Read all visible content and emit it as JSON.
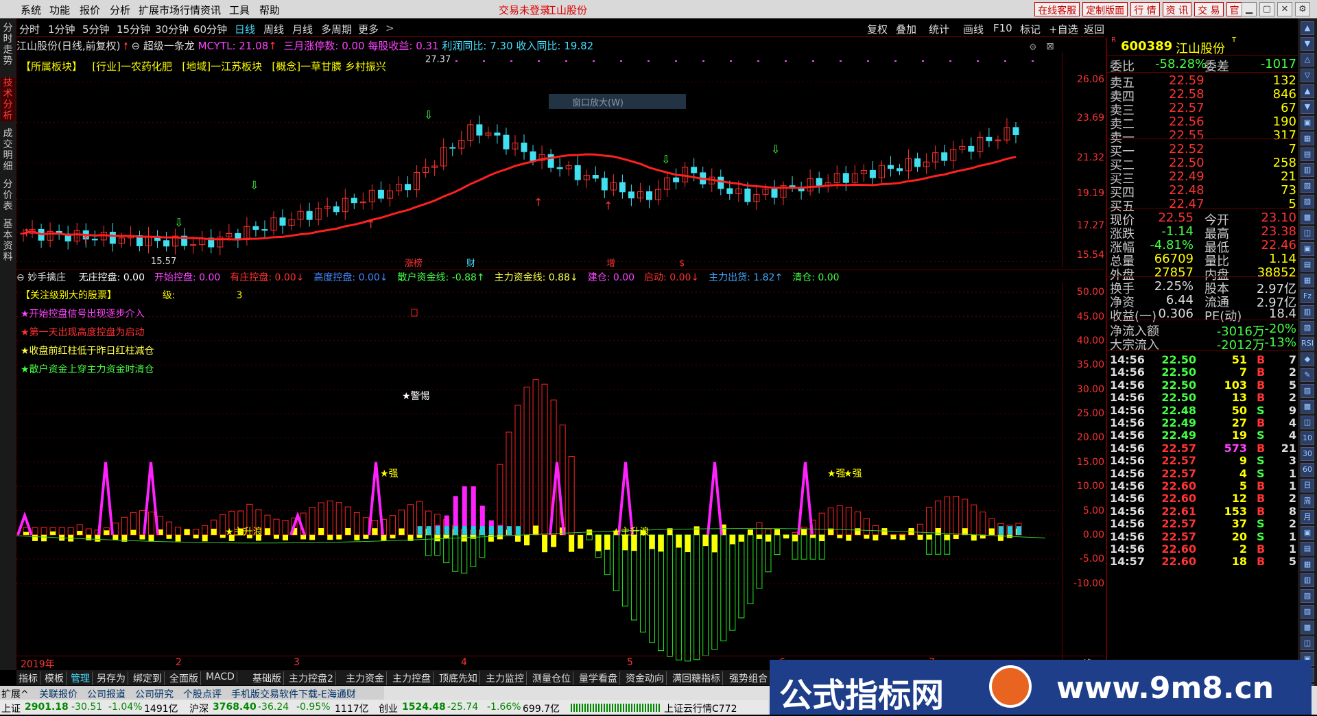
{
  "menu": [
    "系统",
    "功能",
    "报价",
    "分析",
    "扩展市场行情",
    "资讯",
    "工具",
    "帮助"
  ],
  "header_center": {
    "login": "交易未登录",
    "stock": "江山股份"
  },
  "top_buttons": [
    "在线客服",
    "定制版面",
    "行 情",
    "资 讯",
    "交 易",
    "官 网"
  ],
  "left_tabs": [
    "分时走势",
    "技术分析",
    "成交明细",
    "分价表",
    "基本资料"
  ],
  "periods": [
    "分时",
    "1分钟",
    "5分钟",
    "15分钟",
    "30分钟",
    "60分钟",
    "日线",
    "周线",
    "月线",
    "多周期",
    "更多"
  ],
  "toolbar": [
    "复权",
    "叠加",
    "统计",
    "画线",
    "F10",
    "标记",
    "+自选",
    "返回"
  ],
  "main_chart": {
    "title": "江山股份(日线,前复权)",
    "indicator": "超级一条龙",
    "mcytl": "MCYTL: 21.08",
    "march": "三月涨停数: 0.00",
    "eps": "每股收益: 0.31",
    "profit": "利润同比: 7.30",
    "income": "收入同比: 19.82",
    "plates": [
      "【所属板块】",
      "[行业]一农药化肥",
      "[地域]一江苏板块",
      "[概念]一草甘膦 乡村振兴"
    ],
    "high_label": "27.37",
    "low_label": "15.57",
    "yticks": [
      "26.06",
      "23.69",
      "21.32",
      "19.19",
      "17.27",
      "15.54"
    ],
    "markers": [
      "涨榜",
      "财",
      "增",
      "$"
    ],
    "chart_data": {
      "type": "candlestick",
      "ma_color_up": "#ff2020",
      "ma_color_down": "#44dd44",
      "up_color": "#ff3030",
      "down_color": "#40e0f0",
      "yrange": [
        15.2,
        27.8
      ]
    }
  },
  "sub_chart": {
    "name": "妙手擒庄",
    "vals": [
      {
        "k": "无庄控盘:",
        "v": "0.00",
        "c": "#ffffff"
      },
      {
        "k": "开始控盘:",
        "v": "0.00",
        "c": "#ff44ff"
      },
      {
        "k": "有庄控盘:",
        "v": "0.00↓",
        "c": "#ff3030"
      },
      {
        "k": "高度控盘:",
        "v": "0.00↓",
        "c": "#4488ff"
      },
      {
        "k": "散户资金线:",
        "v": "-0.88↑",
        "c": "#44ff44"
      },
      {
        "k": "主力资金线:",
        "v": "0.88↓",
        "c": "#ffff44"
      },
      {
        "k": "建仓:",
        "v": "0.00",
        "c": "#ff44ff"
      },
      {
        "k": "启动:",
        "v": "0.00↓",
        "c": "#ff3030"
      },
      {
        "k": "主力出货:",
        "v": "1.82↑",
        "c": "#44aaff"
      },
      {
        "k": "清仓:",
        "v": "0.00",
        "c": "#44ff44"
      }
    ],
    "notes": [
      {
        "t": "【关注级别大的股票】",
        "c": "#ffff44"
      },
      {
        "t": "★开始控盘信号出现逐步介入",
        "c": "#ff44ff"
      },
      {
        "t": "★第一天出现高度控盘为启动",
        "c": "#ff3030"
      },
      {
        "t": "★收盘前红柱低于昨日红柱减仓",
        "c": "#ffff44"
      },
      {
        "t": "★散户资金上穿主力资金时清仓",
        "c": "#44ff44"
      }
    ],
    "level_label": "级:",
    "level_value": "3",
    "yticks": [
      "50.00",
      "45.00",
      "40.00",
      "35.00",
      "30.00",
      "25.00",
      "20.00",
      "15.00",
      "10.00",
      "5.00",
      "0.00",
      "-5.00",
      "-10.00"
    ],
    "labels": [
      "★警惕",
      "★强",
      "★强",
      "★强",
      "★主升浪",
      "★主升浪"
    ],
    "chart_data": {
      "type": "bar",
      "yrange": [
        -28,
        52
      ]
    }
  },
  "date_axis": [
    "2019年",
    "2",
    "3",
    "4",
    "5",
    "6",
    "7"
  ],
  "date_axis_right": "日线",
  "quote": {
    "code": "600389",
    "name": "江山股份",
    "weibi_label": "委比",
    "weibi": "-58.28%",
    "weicha_label": "委差",
    "weicha": "-1017",
    "sell": [
      {
        "l": "卖五",
        "p": "22.59",
        "v": "132"
      },
      {
        "l": "卖四",
        "p": "22.58",
        "v": "846"
      },
      {
        "l": "卖三",
        "p": "22.57",
        "v": "67"
      },
      {
        "l": "卖二",
        "p": "22.56",
        "v": "190"
      },
      {
        "l": "卖一",
        "p": "22.55",
        "v": "317"
      }
    ],
    "buy": [
      {
        "l": "买一",
        "p": "22.52",
        "v": "7"
      },
      {
        "l": "买二",
        "p": "22.50",
        "v": "258"
      },
      {
        "l": "买三",
        "p": "22.49",
        "v": "21"
      },
      {
        "l": "买四",
        "p": "22.48",
        "v": "73"
      },
      {
        "l": "买五",
        "p": "22.47",
        "v": "5"
      }
    ],
    "stats": [
      {
        "a": "现价",
        "av": "22.55",
        "b": "今开",
        "bv": "23.10"
      },
      {
        "a": "涨跌",
        "av": "-1.14",
        "b": "最高",
        "bv": "23.38"
      },
      {
        "a": "涨幅",
        "av": "-4.81%",
        "b": "最低",
        "bv": "22.46"
      },
      {
        "a": "总量",
        "av": "66709",
        "b": "量比",
        "bv": "1.14"
      },
      {
        "a": "外盘",
        "av": "27857",
        "b": "内盘",
        "bv": "38852"
      }
    ],
    "fund": [
      {
        "a": "换手",
        "av": "2.25%",
        "b": "股本",
        "bv": "2.97亿"
      },
      {
        "a": "净资",
        "av": "6.44",
        "b": "流通",
        "bv": "2.97亿"
      },
      {
        "a": "收益(一)",
        "av": "0.306",
        "b": "PE(动)",
        "bv": "18.4"
      }
    ],
    "flow": [
      {
        "a": "净流入额",
        "v": "-3016万",
        "p": "-20%"
      },
      {
        "a": "大宗流入",
        "v": "-2012万",
        "p": "-13%"
      }
    ],
    "ticks": [
      {
        "t": "14:56",
        "p": "22.50",
        "v": "51",
        "s": "B",
        "n": "7"
      },
      {
        "t": "14:56",
        "p": "22.50",
        "v": "7",
        "s": "B",
        "n": "2"
      },
      {
        "t": "14:56",
        "p": "22.50",
        "v": "103",
        "s": "B",
        "n": "5"
      },
      {
        "t": "14:56",
        "p": "22.50",
        "v": "13",
        "s": "B",
        "n": "2"
      },
      {
        "t": "14:56",
        "p": "22.48",
        "v": "50",
        "s": "S",
        "n": "9"
      },
      {
        "t": "14:56",
        "p": "22.49",
        "v": "27",
        "s": "B",
        "n": "4"
      },
      {
        "t": "14:56",
        "p": "22.49",
        "v": "19",
        "s": "S",
        "n": "4"
      },
      {
        "t": "14:56",
        "p": "22.57",
        "v": "573",
        "s": "B",
        "n": "21"
      },
      {
        "t": "14:56",
        "p": "22.57",
        "v": "9",
        "s": "S",
        "n": "3"
      },
      {
        "t": "14:56",
        "p": "22.57",
        "v": "4",
        "s": "S",
        "n": "1"
      },
      {
        "t": "14:56",
        "p": "22.60",
        "v": "5",
        "s": "B",
        "n": "1"
      },
      {
        "t": "14:56",
        "p": "22.60",
        "v": "12",
        "s": "B",
        "n": "2"
      },
      {
        "t": "14:56",
        "p": "22.61",
        "v": "153",
        "s": "B",
        "n": "8"
      },
      {
        "t": "14:56",
        "p": "22.57",
        "v": "37",
        "s": "S",
        "n": "2"
      },
      {
        "t": "14:56",
        "p": "22.57",
        "v": "20",
        "s": "S",
        "n": "1"
      },
      {
        "t": "14:56",
        "p": "22.60",
        "v": "2",
        "s": "B",
        "n": "1"
      },
      {
        "t": "14:57",
        "p": "22.60",
        "v": "18",
        "s": "B",
        "n": "5"
      }
    ]
  },
  "bottom_tabs": [
    "指标",
    "模板",
    "管理",
    "另存为",
    "绑定到",
    "全面版",
    "MACD",
    "基础版",
    "主力控盘2",
    "主力资金",
    "主力控盘",
    "顶底先知",
    "主力监控",
    "测量仓位",
    "量学看盘",
    "资金动向",
    "满回糖指标",
    "强势组合"
  ],
  "bottom_row2": [
    "扩展^",
    "关联报价",
    "公司报道",
    "公司研究",
    "个股点评",
    "手机版交易软件下载-E海通财"
  ],
  "status": {
    "sh_label": "上证",
    "sh": "2901.18",
    "sh_chg": "-30.51",
    "sh_pct": "-1.04%",
    "sh_amt": "1491亿",
    "hs_label": "沪深",
    "hs": "3768.40",
    "hs_chg": "-36.24",
    "hs_pct": "-0.95%",
    "hs_amt": "1117亿",
    "cy_label": "创业",
    "cy": "1524.48",
    "cy_chg": "-25.74",
    "cy_pct": "-1.66%",
    "cy_amt": "699.7亿",
    "cloud": "上证云行情C772"
  },
  "watermark": {
    "text": "公式指标网",
    "url": "www.9m8.cn"
  },
  "popup": "窗口放大(W)"
}
